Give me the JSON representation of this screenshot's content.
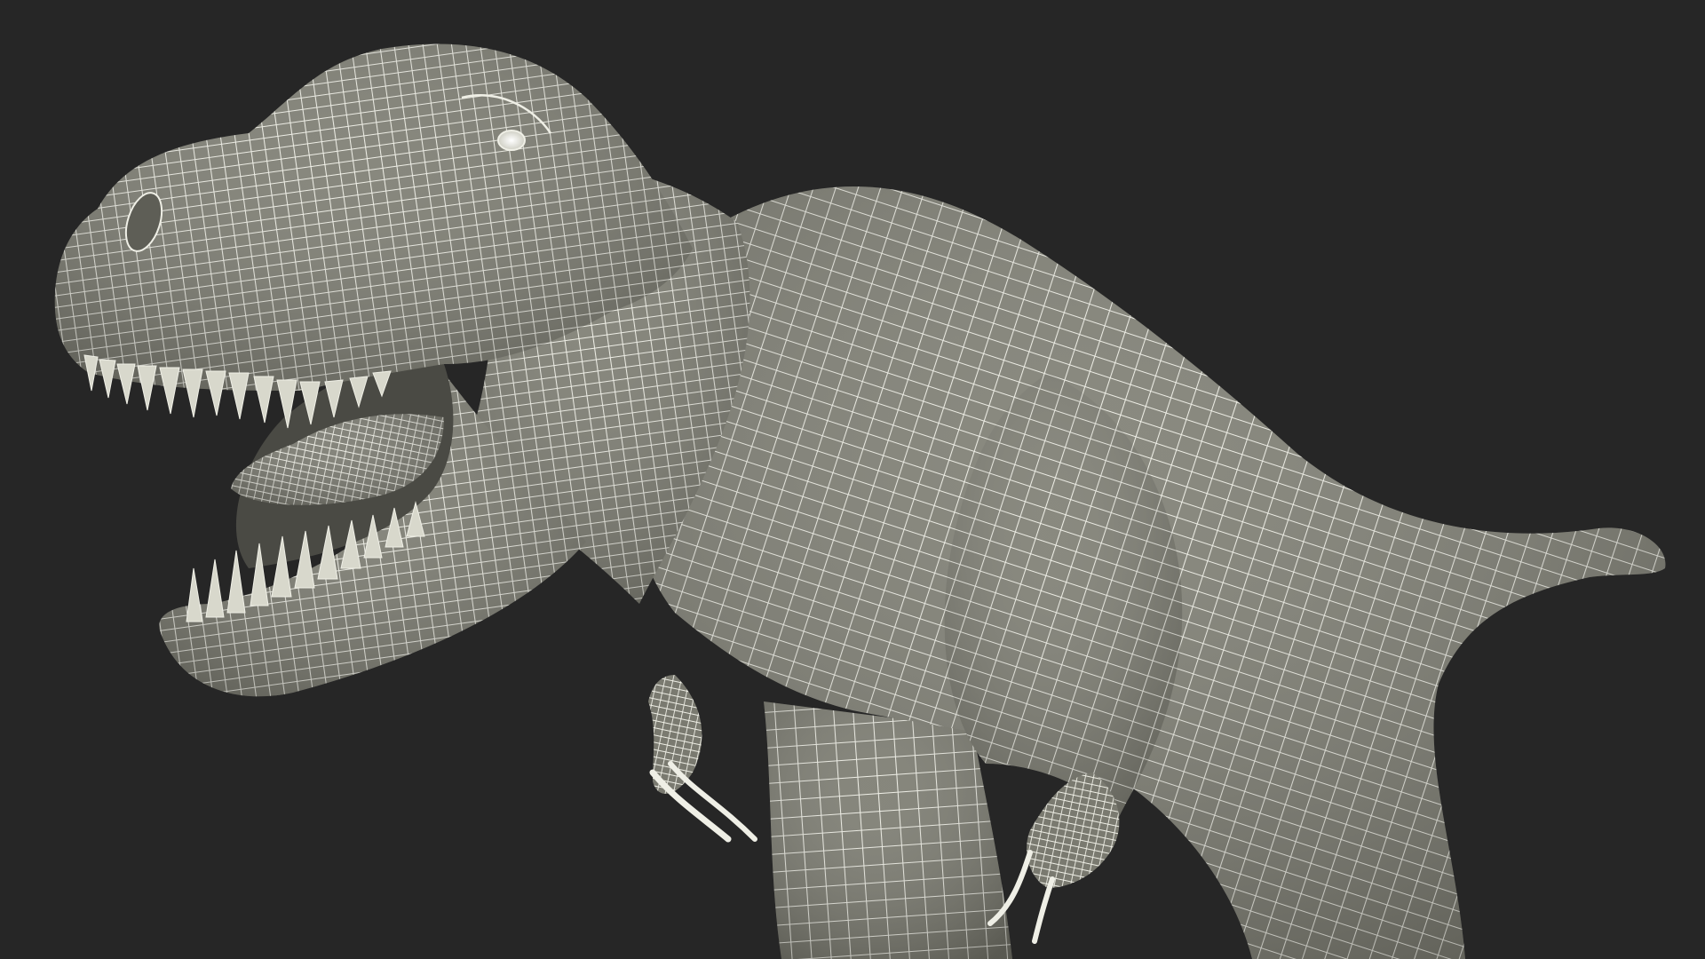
{
  "scene": {
    "subject": "t-rex-wireframe-model",
    "background_color": "#262626",
    "mesh_fill_color": "#7d7d72",
    "mesh_shadow_color": "#5a5a52",
    "mesh_line_color": "#efefe6",
    "eye_color": "#f4f4ec"
  }
}
